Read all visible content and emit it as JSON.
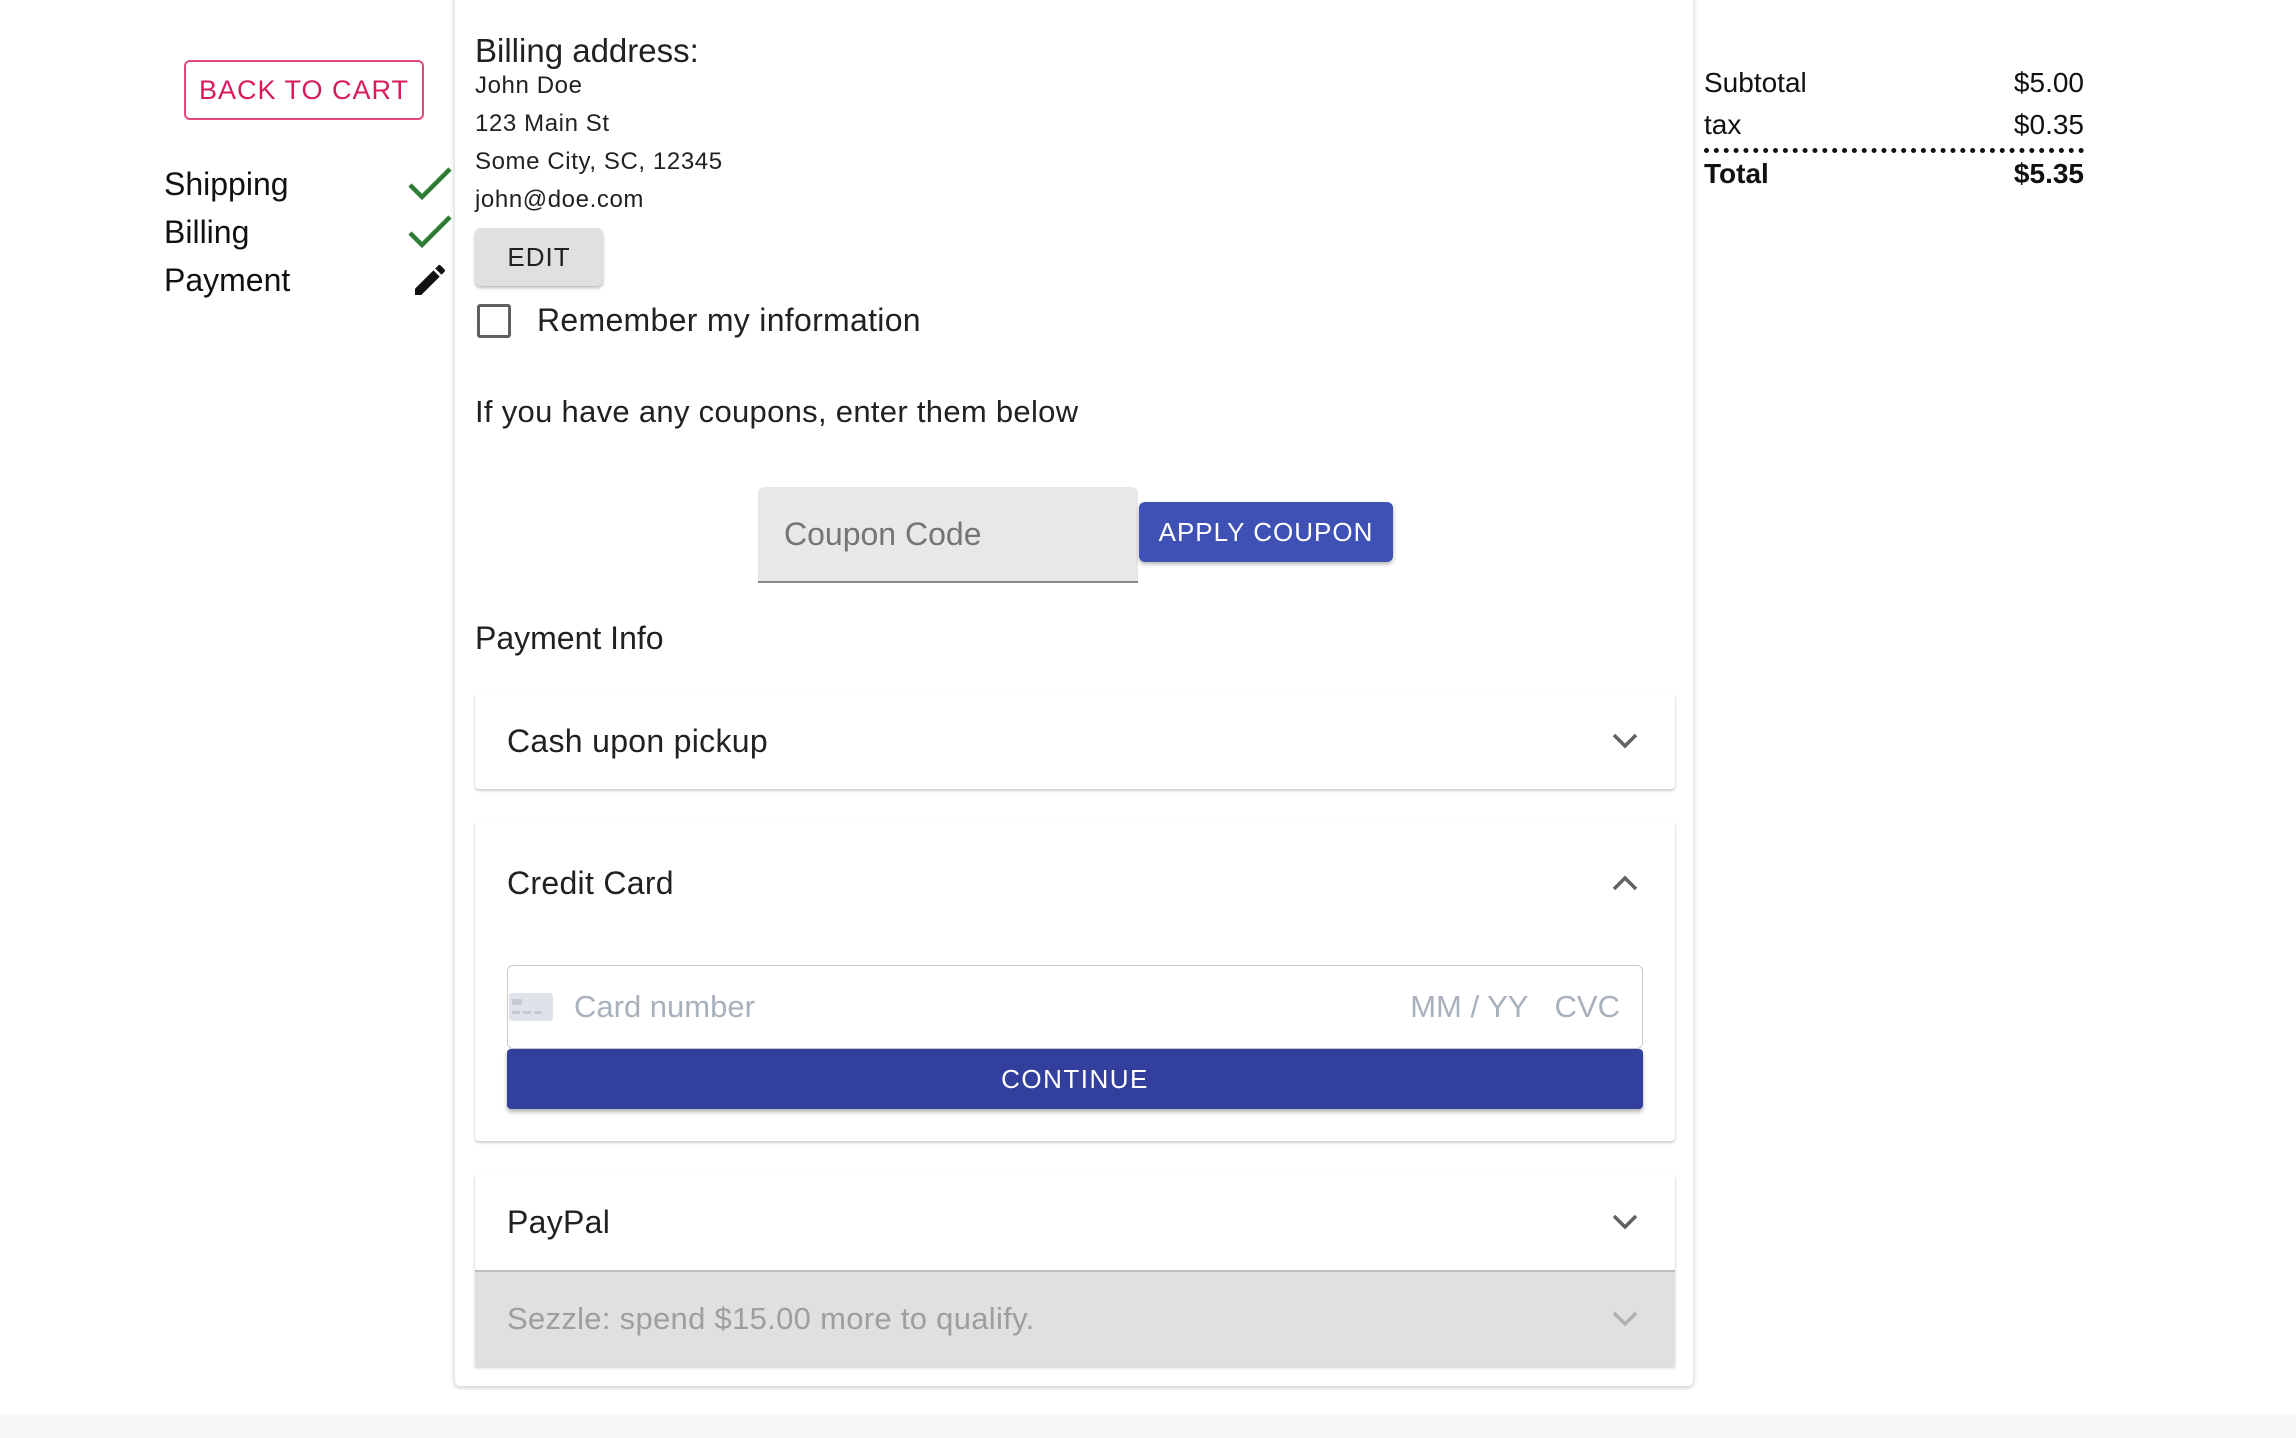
{
  "nav": {
    "back_label": "BACK TO CART",
    "steps": [
      {
        "label": "Shipping",
        "icon": "check-icon",
        "status": "complete"
      },
      {
        "label": "Billing",
        "icon": "check-icon",
        "status": "complete"
      },
      {
        "label": "Payment",
        "icon": "pencil-icon",
        "status": "active"
      }
    ]
  },
  "billing": {
    "title": "Billing address:",
    "name": "John Doe",
    "street": "123 Main St",
    "city_line": "Some City, SC, 12345",
    "email": "john@doe.com",
    "edit_label": "EDIT"
  },
  "remember": {
    "label": "Remember my information",
    "checked": false
  },
  "coupon": {
    "prompt": "If you have any coupons, enter them below",
    "placeholder": "Coupon Code",
    "value": "",
    "apply_label": "APPLY COUPON"
  },
  "payment": {
    "title": "Payment Info",
    "methods": [
      {
        "label": "Cash upon pickup",
        "expanded": false
      },
      {
        "label": "Credit Card",
        "expanded": true
      },
      {
        "label": "PayPal",
        "expanded": false
      }
    ],
    "card": {
      "number_placeholder": "Card number",
      "expiry_placeholder": "MM / YY",
      "cvc_placeholder": "CVC",
      "continue_label": "CONTINUE"
    },
    "sezzle_label": "Sezzle: spend $15.00 more to qualify."
  },
  "summary": {
    "subtotal_label": "Subtotal",
    "subtotal_value": "$5.00",
    "tax_label": "tax",
    "tax_value": "$0.35",
    "total_label": "Total",
    "total_value": "$5.35"
  },
  "colors": {
    "accent": "#3f51b5",
    "continue": "#333f9c",
    "back_button": "#d81b60",
    "check": "#2e7d32"
  }
}
